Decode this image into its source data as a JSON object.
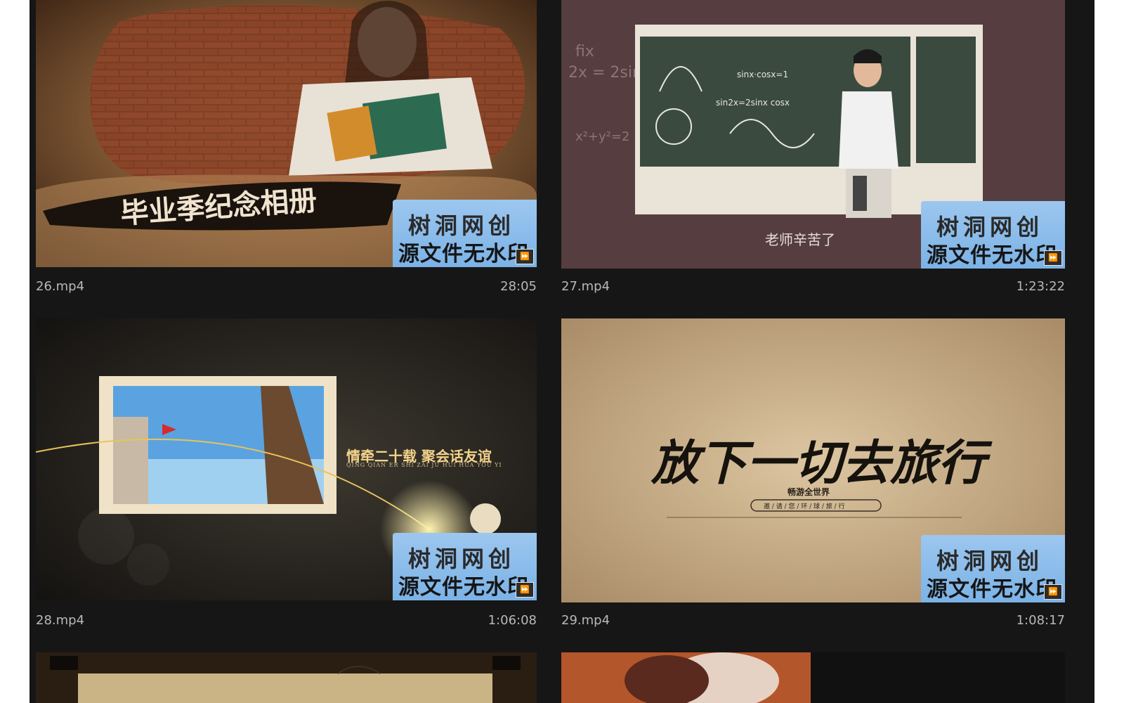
{
  "watermark": {
    "line1": "树洞网创",
    "line2": "源文件无水印",
    "badge_icon": "film-icon"
  },
  "videos": [
    {
      "filename": "26.mp4",
      "duration": "28:05",
      "overlay_text": "毕业季纪念相册"
    },
    {
      "filename": "27.mp4",
      "duration": "1:23:22",
      "overlay_text": "老师辛苦了"
    },
    {
      "filename": "28.mp4",
      "duration": "1:06:08",
      "overlay_text": "情牵二十载  聚会话友谊",
      "overlay_sub": "QING QIAN ER SHI ZAI  JU HUI HUA YOU YI"
    },
    {
      "filename": "29.mp4",
      "duration": "1:08:17",
      "overlay_text": "放下一切去旅行",
      "overlay_sub": "畅游全世界",
      "overlay_sub2": "邀 / 请 / 您 / 环 / 球 / 旅 / 行"
    }
  ],
  "colors": {
    "panel_bg": "#161616",
    "watermark_bg": "#8ec0ec",
    "meta_text": "#b8b8b8"
  }
}
